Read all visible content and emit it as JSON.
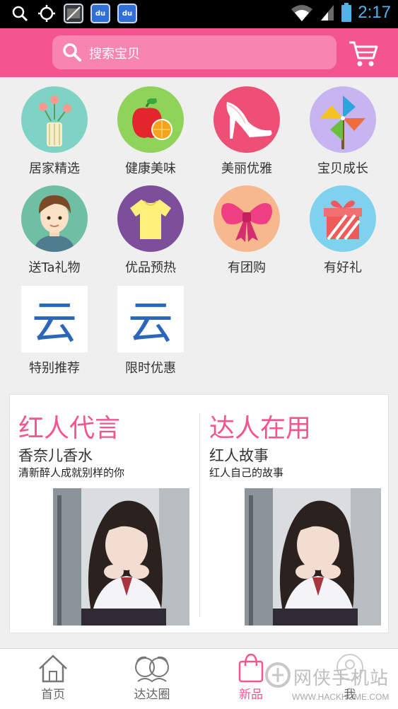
{
  "status_bar": {
    "time": "2:17",
    "notification_icons": [
      "search-icon",
      "gps-icon",
      "no-image-icon",
      "baidu-app-icon",
      "baidu-app-icon"
    ]
  },
  "header": {
    "search_placeholder": "搜索宝贝",
    "cart_icon": "shopping-cart-icon",
    "color": "#f4558f"
  },
  "categories": [
    {
      "label": "居家精选",
      "icon": "vase-flowers-icon",
      "color": "#7fd3c4"
    },
    {
      "label": "健康美味",
      "icon": "apple-orange-icon",
      "color": "#8fd35a"
    },
    {
      "label": "美丽优雅",
      "icon": "high-heel-icon",
      "color": "#ee4f74"
    },
    {
      "label": "宝贝成长",
      "icon": "pinwheel-icon",
      "color": "#c7b5f2"
    },
    {
      "label": "送Ta礼物",
      "icon": "man-avatar-icon",
      "color": "#6fbfa5"
    },
    {
      "label": "优品预热",
      "icon": "tshirt-icon",
      "color": "#7d4f9a"
    },
    {
      "label": "有团购",
      "icon": "bow-icon",
      "color": "#f7b88d"
    },
    {
      "label": "有好礼",
      "icon": "gift-box-icon",
      "color": "#7fd2ee"
    },
    {
      "label": "特别推荐",
      "icon": "yun-placeholder-icon",
      "glyph": "云",
      "color": "#2a67b8"
    },
    {
      "label": "限时优惠",
      "icon": "yun-placeholder-icon",
      "glyph": "云",
      "color": "#2a67b8"
    }
  ],
  "promos": [
    {
      "title": "红人代言",
      "subtitle": "香奈儿香水",
      "description": "清新醉人成就别样的你"
    },
    {
      "title": "达人在用",
      "subtitle": "红人故事",
      "description": "红人自己的故事"
    }
  ],
  "bottom_nav": [
    {
      "label": "首页",
      "icon": "home-icon",
      "active": false
    },
    {
      "label": "达达圈",
      "icon": "girls-circle-icon",
      "active": false
    },
    {
      "label": "新品",
      "icon": "shopping-bag-icon",
      "active": true
    },
    {
      "label": "我",
      "icon": "profile-icon",
      "active": false
    }
  ],
  "watermark": {
    "text": "网侠手机站",
    "url": "WWW.HACKHOME.COM"
  }
}
